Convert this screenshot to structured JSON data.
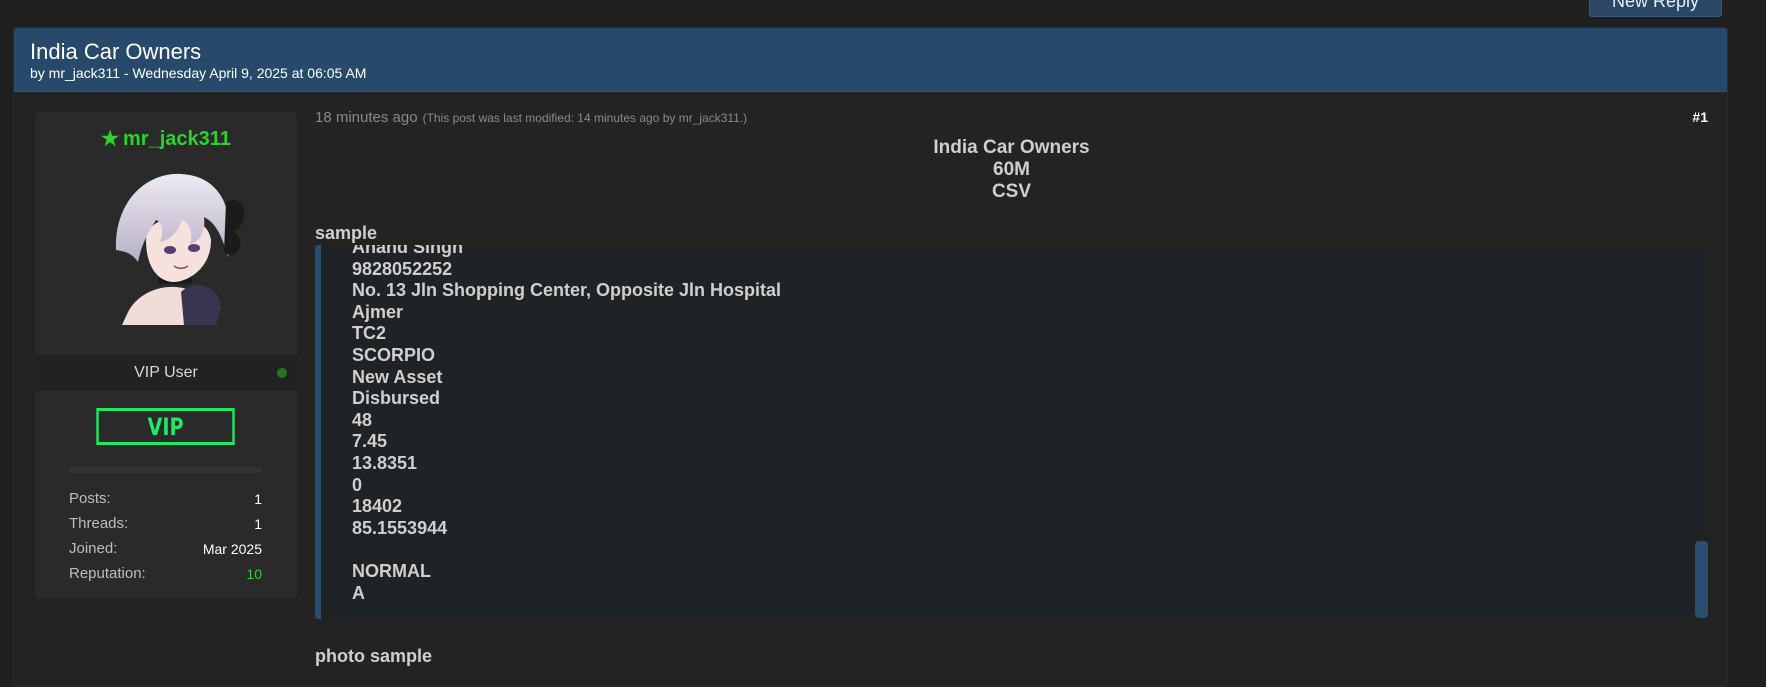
{
  "header": {
    "new_reply_label": "New Reply"
  },
  "thread": {
    "title": "India Car Owners",
    "meta": "by mr_jack311 - Wednesday April 9, 2025 at 06:05 AM"
  },
  "user": {
    "username": "mr_jack311",
    "star_icon": "star-icon",
    "rank": "VIP User",
    "badge": "VIP",
    "stats": [
      {
        "label": "Posts:",
        "value": "1"
      },
      {
        "label": "Threads:",
        "value": "1"
      },
      {
        "label": "Joined:",
        "value": "Mar 2025"
      },
      {
        "label": "Reputation:",
        "value": "10"
      }
    ],
    "colors": {
      "username": "#2fd12f",
      "badge": "#1ee865",
      "online": "#1f7a1f"
    }
  },
  "post": {
    "time": "18 minutes ago",
    "modified": "(This post was last modified: 14 minutes ago by mr_jack311.)",
    "number": "#1",
    "center_lines": [
      "India Car Owners",
      "60M",
      "CSV"
    ],
    "sample_label": "sample",
    "photo_label": "photo sample",
    "code_lines": [
      "Anand Singh",
      "9828052252",
      "No. 13 Jln Shopping Center, Opposite Jln Hospital",
      "Ajmer",
      "TC2",
      "SCORPIO",
      "New Asset",
      "Disbursed",
      "48",
      "7.45",
      "13.8351",
      "0",
      "18402",
      "85.1553944",
      "",
      "NORMAL",
      "A"
    ]
  }
}
